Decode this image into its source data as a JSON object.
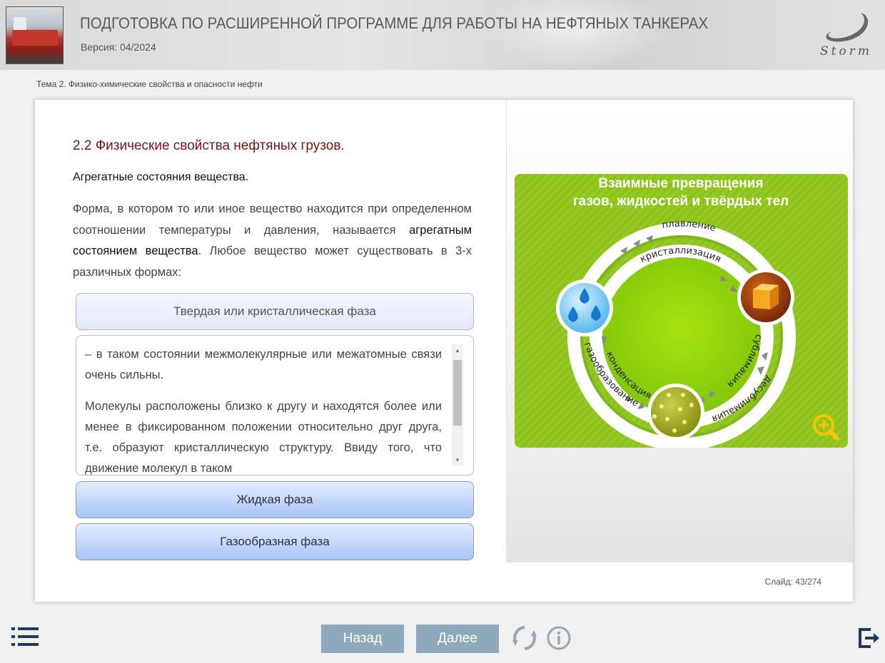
{
  "header": {
    "title": "ПОДГОТОВКА ПО РАСШИРЕННОЙ ПРОГРАММЕ ДЛЯ РАБОТЫ НА НЕФТЯНЫХ ТАНКЕРАХ",
    "version": "Версия: 04/2024",
    "logo_text": "Storm",
    "logo_icon": "storm-swoosh-icon"
  },
  "breadcrumb": "Тема 2. Физико-химические свойства и опасности нефти",
  "content": {
    "section_title": "2.2 Физические свойства нефтяных грузов.",
    "subtitle": "Агрегатные состояния вещества.",
    "para_part1": "Форма, в котором то или иное вещество находится при определенном соотношении температуры и давления, называется ",
    "para_bold": "агрегатным состоянием вещества",
    "para_part2": ". Любое вещество может существовать в 3-х различных формах:",
    "accordion": [
      {
        "label": "Твердая или кристаллическая фаза",
        "expanded": true,
        "text_1": "– в таком состоянии межмолекулярные или межатомные связи очень сильны.",
        "text_2": "Молекулы расположены близко к другу и находятся более или менее в фиксированном положении относительно друг друга, т.е. образуют кристаллическую структуру. Ввиду того, что движение молекул в таком"
      },
      {
        "label": "Жидкая фаза",
        "expanded": false
      },
      {
        "label": "Газообразная фаза",
        "expanded": false
      }
    ]
  },
  "diagram": {
    "title_line1": "Взаимные превращения",
    "title_line2": "газов, жидкостей и твёрдых тел",
    "labels": {
      "melting": "плавление",
      "crystallization": "кристаллизация",
      "sublimation": "сублимация",
      "desublimation": "десублимация",
      "condensation": "конденсация",
      "vaporization": "газообразование"
    },
    "nodes": [
      "liquid-drops-icon",
      "solid-cube-icon",
      "gas-particles-icon"
    ],
    "zoom_icon": "zoom-in-icon",
    "colors": {
      "background": "#8cc21a",
      "ring": "#ffffff",
      "zoom": "#f5c400"
    }
  },
  "slide": {
    "label": "Слайд:",
    "current": "43",
    "separator": "/",
    "total": "274"
  },
  "nav": {
    "back": "Назад",
    "next": "Далее",
    "menu_icon": "menu-list-icon",
    "reload_icon": "reload-icon",
    "info_icon": "info-icon",
    "exit_icon": "exit-icon",
    "button_color": "#8fa9bc"
  }
}
